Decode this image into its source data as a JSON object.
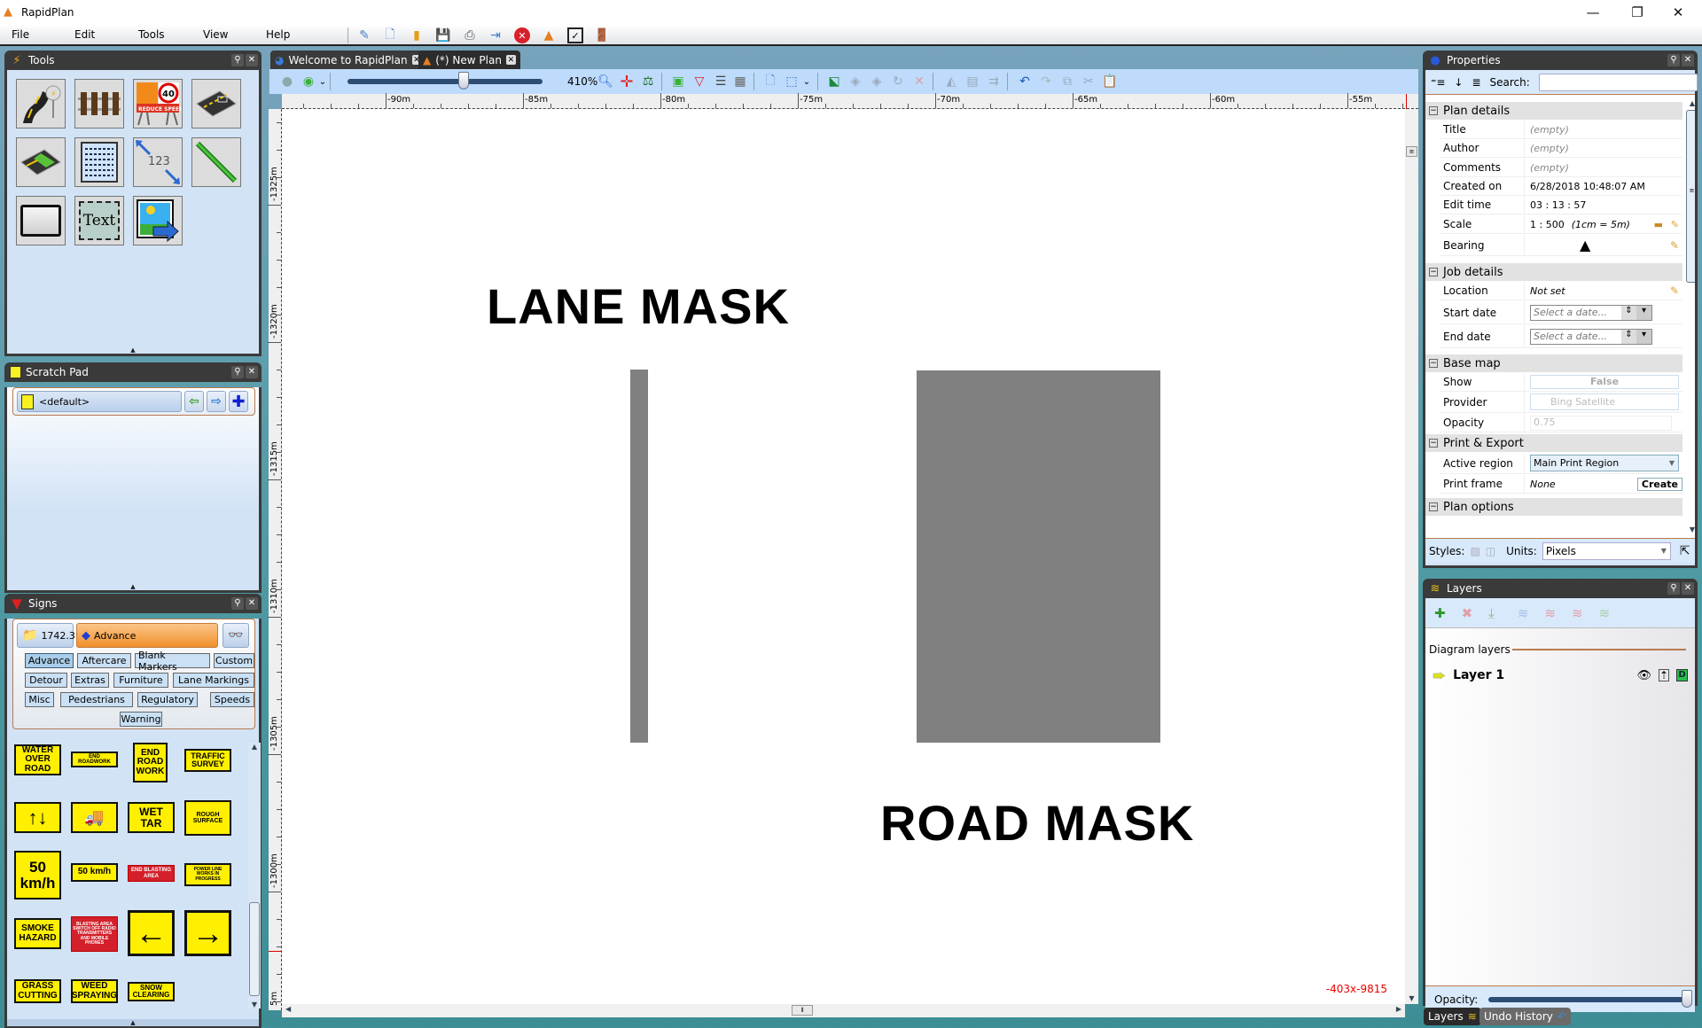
{
  "app": {
    "title": "RapidPlan"
  },
  "window_controls": {
    "minimize": "—",
    "restore": "❐",
    "close": "✕"
  },
  "menu": {
    "items": [
      "File",
      "Edit",
      "Tools",
      "View",
      "Help"
    ]
  },
  "main_toolbar": {
    "icons": [
      "new-plan-wizard-icon",
      "new-document-icon",
      "open-folder-icon",
      "save-icon",
      "print-icon",
      "export-icon",
      "close-red-icon",
      "rapidplan-cone-icon",
      "checkbox-icon",
      "exit-door-icon"
    ]
  },
  "panels": {
    "tools": {
      "title": "Tools",
      "items": [
        "road-tool",
        "rail-tool",
        "reduce-speed-sign-tool",
        "road-mask-tool",
        "lane-mask-tool",
        "text-block-tool",
        "dimension-tool",
        "line-tool",
        "rectangle-tool",
        "text-tool",
        "image-tool"
      ],
      "dimension_label": "123",
      "text_label": "Text",
      "sign_speed": "40",
      "sign_caption": "REDUCE SPEED"
    },
    "scratch_pad": {
      "title": "Scratch Pad",
      "selected": "<default>"
    },
    "signs": {
      "title": "Signs",
      "standard": "1742.3",
      "category_selected": "Advance",
      "categories": [
        "Advance",
        "Aftercare",
        "Blank Markers",
        "Custom",
        "Detour",
        "Extras",
        "Furniture",
        "Lane Markings",
        "Misc",
        "Pedestrians",
        "Regulatory",
        "Speeds",
        "Warning"
      ],
      "items": [
        {
          "text": "WATER OVER ROAD"
        },
        {
          "text": "END ROADWORK"
        },
        {
          "text": "END ROAD WORK"
        },
        {
          "text": "TRAFFIC SURVEY"
        },
        {
          "text": "↑↓"
        },
        {
          "text": "🚚"
        },
        {
          "text": "WET TAR"
        },
        {
          "text": "ROUGH SURFACE"
        },
        {
          "text": "50 km/h"
        },
        {
          "text": "50 km/h"
        },
        {
          "text": "END BLASTING AREA"
        },
        {
          "text": "POWER LINE WORKS IN PROGRESS"
        },
        {
          "text": "SMOKE HAZARD"
        },
        {
          "text": "BLASTING AREA SWITCH OFF RADIO TRANSMITTERS AND MOBILE PHONES"
        },
        {
          "text": "←"
        },
        {
          "text": "→"
        },
        {
          "text": "GRASS CUTTING"
        },
        {
          "text": "WEED SPRAYING"
        },
        {
          "text": "SNOW CLEARING"
        }
      ]
    }
  },
  "document": {
    "tabs": [
      {
        "label": "Welcome to RapidPlan",
        "active": false
      },
      {
        "label": "(*) New Plan",
        "active": true
      }
    ],
    "zoom_level": "410%",
    "zoom_fraction": 0.6,
    "ruler_h": [
      "-90m",
      "-85m",
      "-80m",
      "-75m",
      "-70m",
      "-65m",
      "-60m",
      "-55m"
    ],
    "ruler_v": [
      "-1325m",
      "-1320m",
      "-1315m",
      "-1310m",
      "-1305m",
      "-1300m",
      "5m"
    ],
    "canvas": {
      "labels": {
        "lane_mask": "LANE MASK",
        "road_mask": "ROAD MASK"
      },
      "shape_color": "#808080"
    },
    "coordinates": "-403x-9815"
  },
  "properties": {
    "title": "Properties",
    "search_label": "Search:",
    "search_value": "",
    "sections": {
      "plan_details": "Plan details",
      "job_details": "Job details",
      "base_map": "Base map",
      "print_export": "Print & Export",
      "plan_options": "Plan options"
    },
    "plan": {
      "title_k": "Title",
      "title_v": "(empty)",
      "author_k": "Author",
      "author_v": "(empty)",
      "comments_k": "Comments",
      "comments_v": "(empty)",
      "created_k": "Created on",
      "created_v": "6/28/2018 10:48:07 AM",
      "edit_k": "Edit time",
      "edit_v": "03 : 13 : 57",
      "scale_k": "Scale",
      "scale_v": "1 : 500",
      "scale_note": "(1cm = 5m)",
      "bearing_k": "Bearing"
    },
    "job": {
      "location_k": "Location",
      "location_v": "Not set",
      "start_k": "Start date",
      "start_placeholder": "Select a date...",
      "end_k": "End date",
      "end_placeholder": "Select a date..."
    },
    "basemap": {
      "show_k": "Show",
      "show_v": "False",
      "provider_k": "Provider",
      "provider_v": "Bing Satellite",
      "opacity_k": "Opacity",
      "opacity_v": "0.75"
    },
    "print": {
      "region_k": "Active region",
      "region_v": "Main Print Region",
      "frame_k": "Print frame",
      "frame_v": "None",
      "create_label": "Create"
    },
    "footer": {
      "styles_label": "Styles:",
      "units_label": "Units:",
      "units_value": "Pixels"
    }
  },
  "layers": {
    "title": "Layers",
    "group_label": "Diagram layers",
    "items": [
      {
        "name": "Layer 1",
        "visible": true,
        "locked": false
      }
    ],
    "opacity_label": "Opacity:",
    "opacity": 1.0
  },
  "bottom_tabs": [
    {
      "label": "Layers",
      "active": true
    },
    {
      "label": "Undo History",
      "active": false
    }
  ]
}
